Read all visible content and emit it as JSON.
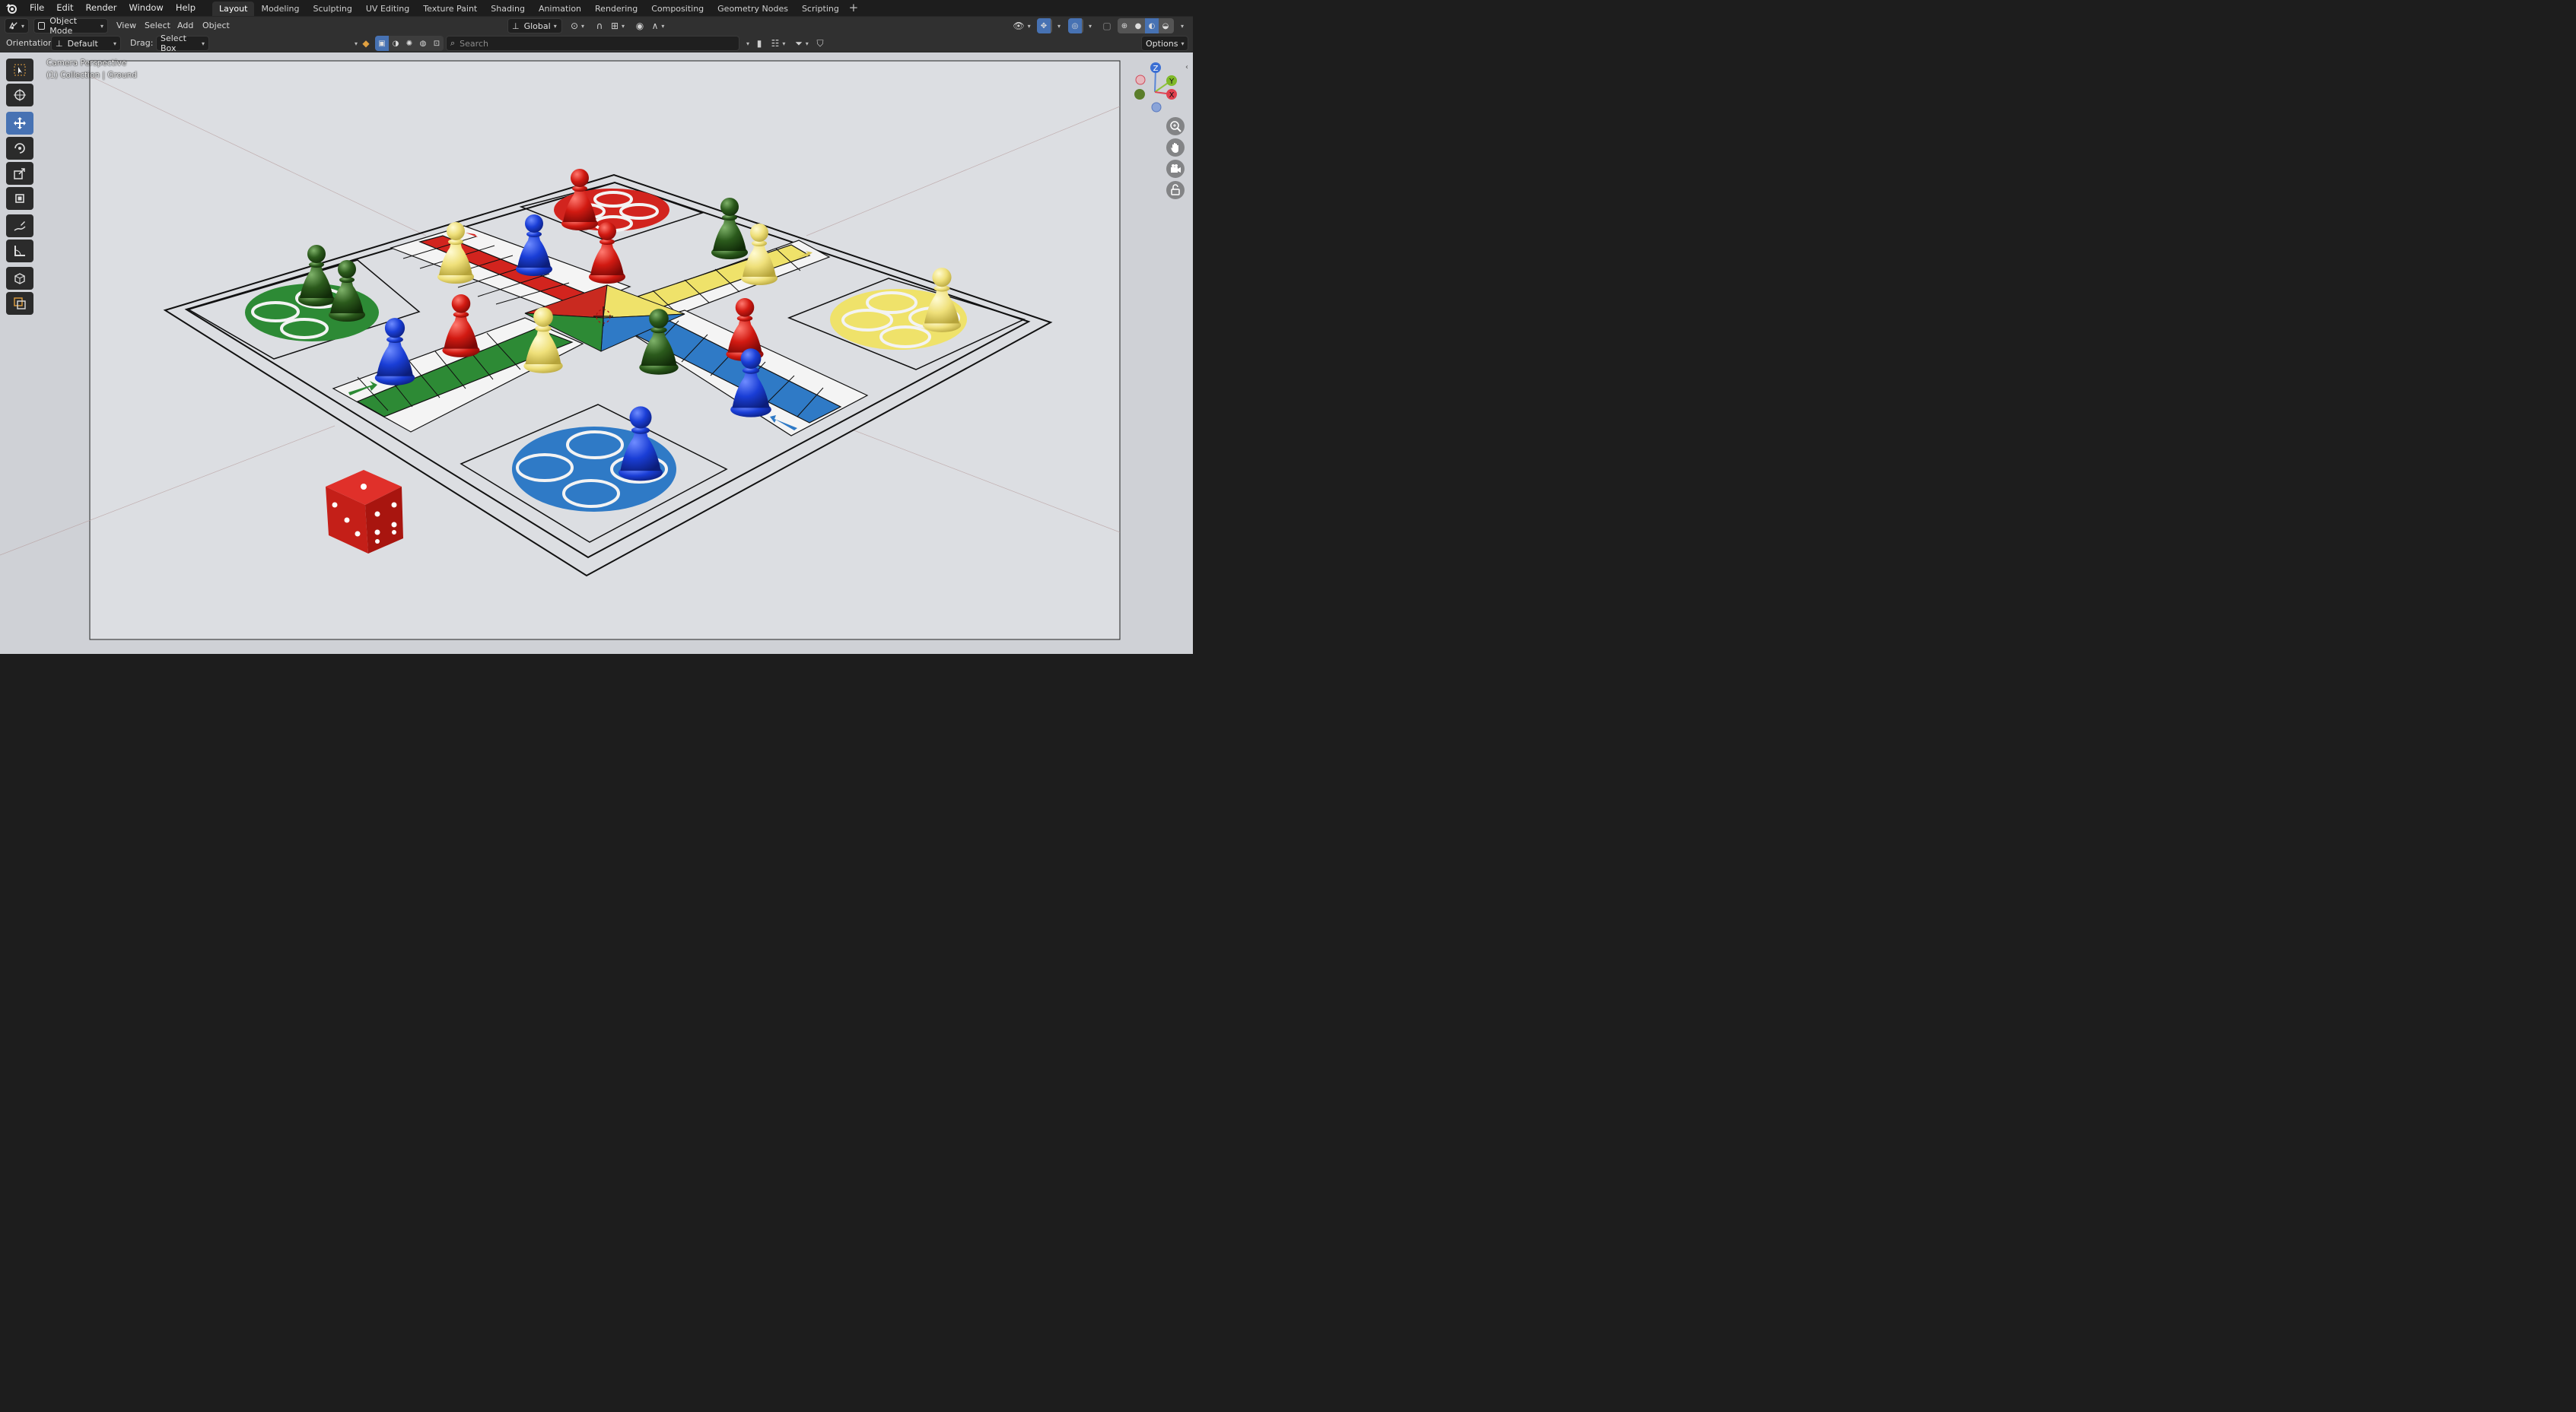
{
  "menubar": {
    "items": [
      "File",
      "Edit",
      "Render",
      "Window",
      "Help"
    ],
    "workspaces": [
      "Layout",
      "Modeling",
      "Sculpting",
      "UV Editing",
      "Texture Paint",
      "Shading",
      "Animation",
      "Rendering",
      "Compositing",
      "Geometry Nodes",
      "Scripting"
    ],
    "active_workspace": "Layout",
    "add_tab": "+"
  },
  "header": {
    "mode": "Object Mode",
    "menus": [
      "View",
      "Select",
      "Add",
      "Object"
    ],
    "transform_orientation": "Global"
  },
  "tool_settings": {
    "orientation_label": "Orientation:",
    "orientation_value": "Default",
    "drag_label": "Drag:",
    "drag_value": "Select Box",
    "search_placeholder": "Search",
    "options_label": "Options"
  },
  "viewport": {
    "perspective_label": "Camera Perspective",
    "collection_label": "(1) Collection | Ground",
    "gizmo_axes": {
      "z": "Z",
      "y": "Y",
      "x": "X"
    }
  },
  "colors": {
    "accent": "#4772b3",
    "red": "#d2241e",
    "green": "#2d8a35",
    "blue": "#2f7ac6",
    "yellow": "#efe26a",
    "background": "#d0d2d7"
  },
  "toolbar": [
    "select-box-icon",
    "cursor-icon",
    "move-icon",
    "rotate-icon",
    "scale-icon",
    "transform-icon",
    "annotate-icon",
    "measure-icon",
    "add-cube-icon",
    "scale-cage-icon"
  ],
  "active_tool": "move-icon"
}
